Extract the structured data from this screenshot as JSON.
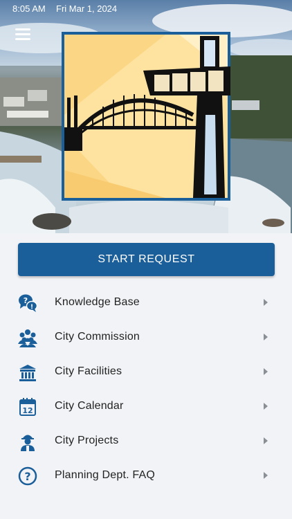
{
  "status_bar": {
    "time": "8:05 AM",
    "date": "Fri Mar 1, 2024"
  },
  "header": {
    "menu_icon": "hamburger-menu-icon",
    "logo_icon": "city-logo-bridge-tower"
  },
  "primary_action": {
    "label": "START REQUEST"
  },
  "menu": {
    "items": [
      {
        "label": "Knowledge Base",
        "icon": "question-bubbles-icon"
      },
      {
        "label": "City Commission",
        "icon": "people-group-icon"
      },
      {
        "label": "City Facilities",
        "icon": "building-icon"
      },
      {
        "label": "City Calendar",
        "icon": "calendar-icon"
      },
      {
        "label": "City Projects",
        "icon": "worker-hardhat-icon"
      },
      {
        "label": "Planning Dept. FAQ",
        "icon": "question-circle-icon"
      }
    ]
  },
  "colors": {
    "brand": "#1a5e9a",
    "icon": "#1a5e9a",
    "background": "#f1f3f6"
  }
}
